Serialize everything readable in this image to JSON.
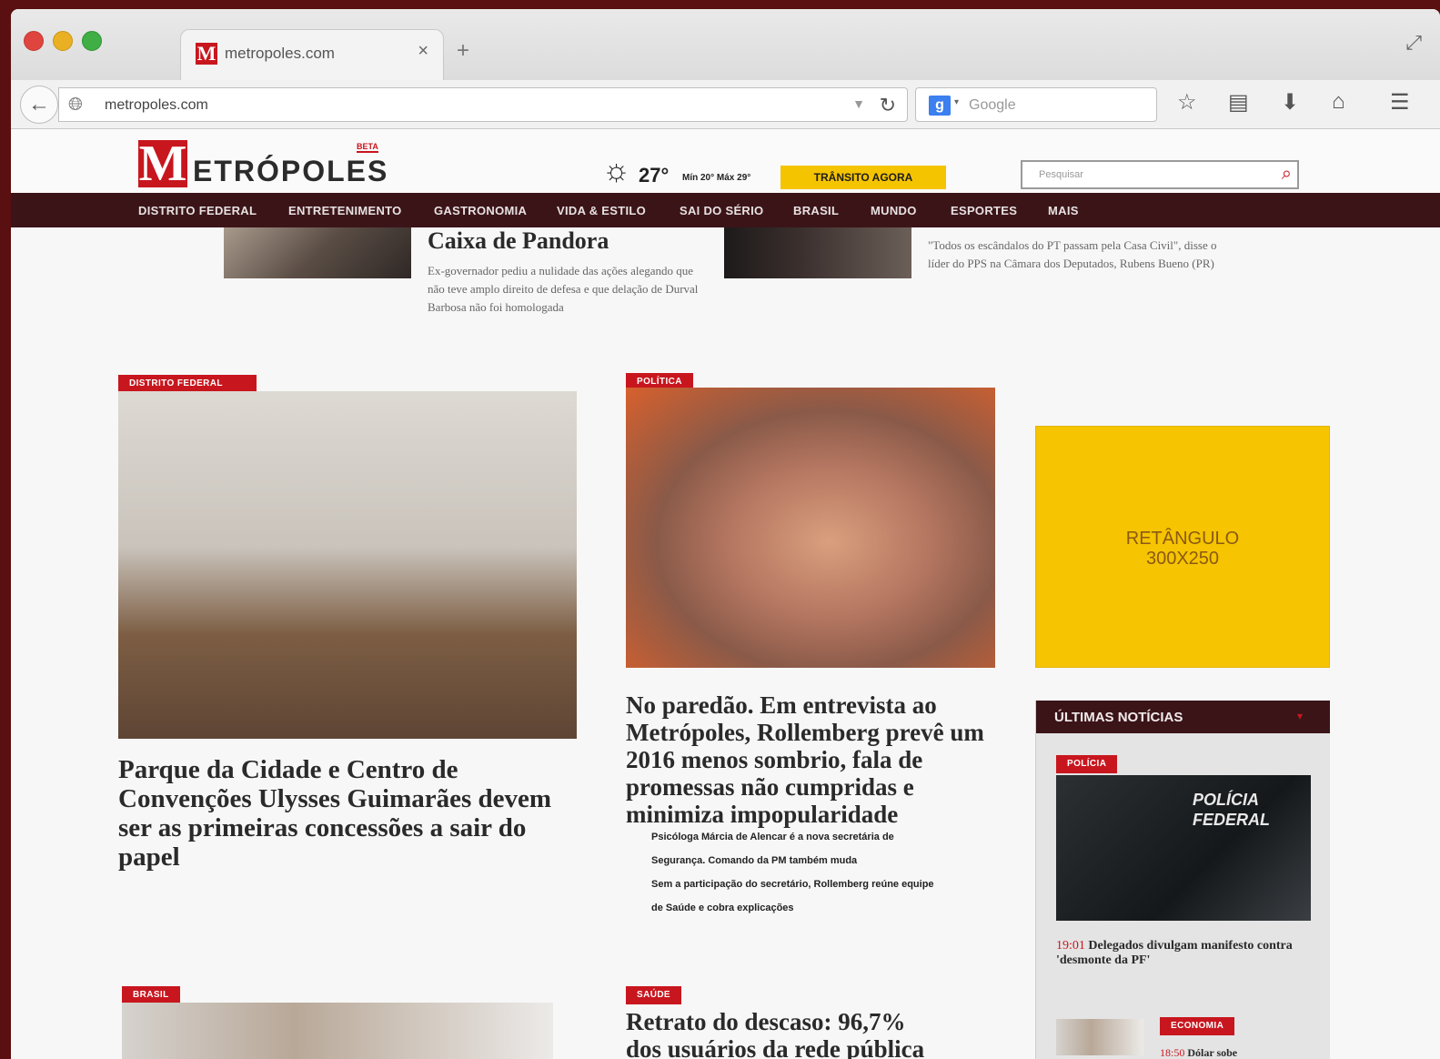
{
  "browser": {
    "tab_title": "metropoles.com",
    "tab_close": "×",
    "new_tab": "+",
    "url": "metropoles.com",
    "search_engine": "Google",
    "search_engine_badge": "g",
    "icons": [
      "back-arrow-icon",
      "globe-icon",
      "reload-icon",
      "star-icon",
      "clipboard-icon",
      "download-icon",
      "home-icon",
      "menu-icon",
      "fullscreen-icon"
    ]
  },
  "site": {
    "logo_m": "M",
    "logo_rest": "ETRÓPOLES",
    "logo_beta": "BETA",
    "temp": "27°",
    "minmax": "Mín 20° Máx 29°",
    "transito": "TRÂNSITO AGORA",
    "search_placeholder": "Pesquisar",
    "nav": [
      "DISTRITO FEDERAL",
      "ENTRETENIMENTO",
      "GASTRONOMIA",
      "VIDA & ESTILO",
      "SAI DO SÉRIO",
      "BRASIL",
      "MUNDO",
      "ESPORTES",
      "MAIS"
    ]
  },
  "top_stories": {
    "left_title": "Caixa de Pandora",
    "left_summary": "Ex-governador pediu a nulidade das ações alegando que não teve amplo direito de defesa e que delação de Durval Barbosa não foi homologada",
    "right_quote": "\"Todos os escândalos do PT passam pela Casa Civil\", disse o líder do PPS na Câmara dos Deputados, Rubens Bueno (PR)"
  },
  "featured": [
    {
      "badge": "DISTRITO FEDERAL",
      "title": "Parque da Cidade e Centro de Convenções Ulysses Guimarães devem ser as primeiras concessões a sair do papel"
    },
    {
      "badge": "POLÍTICA",
      "title": "No paredão. Em entrevista ao Metrópoles, Rollemberg prevê um 2016 menos sombrio, fala de promessas não cumpridas e minimiza impopularidade",
      "related": [
        "Psicóloga Márcia de Alencar é a nova secretária de",
        "Segurança. Comando da PM também muda",
        "Sem a participação do secretário, Rollemberg reúne equipe",
        "de Saúde e cobra explicações"
      ]
    }
  ],
  "bottom": [
    {
      "badge": "BRASIL"
    },
    {
      "badge": "SAÚDE",
      "title_line1": "Retrato do descaso: 96,7%",
      "title_line2": "dos usuários da rede pública"
    }
  ],
  "ad": {
    "line1": "RETÂNGULO",
    "line2": "300X250"
  },
  "sidebar": {
    "title": "ÚLTIMAS NOTÍCIAS",
    "caret": "▾",
    "item1": {
      "badge": "POLÍCIA",
      "image_text_1": "POLÍCIA",
      "image_text_2": "FEDERAL",
      "time": "19:01",
      "headline": "Delegados divulgam manifesto contra 'desmonte da PF'"
    },
    "item2": {
      "badge": "ECONOMIA",
      "time": "18:50",
      "headline": "Dólar sobe"
    }
  },
  "colors": {
    "brand_red": "#c8161e",
    "nav_bg": "#3b1418",
    "ad_yellow": "#f6c400",
    "transito_yellow": "#f5c400"
  }
}
